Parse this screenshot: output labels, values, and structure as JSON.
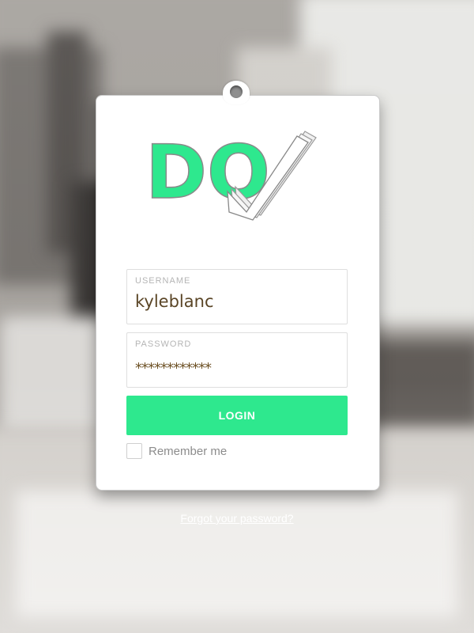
{
  "brand": {
    "logo_text": "DO",
    "accent": "#2ee88e"
  },
  "form": {
    "username_label": "USERNAME",
    "username_value": "kyleblanc",
    "password_label": "PASSWORD",
    "password_value": "************",
    "login_label": "LOGIN",
    "remember_label": "Remember me",
    "remember_checked": false
  },
  "footer": {
    "forgot_link": "Forgot your password?"
  }
}
